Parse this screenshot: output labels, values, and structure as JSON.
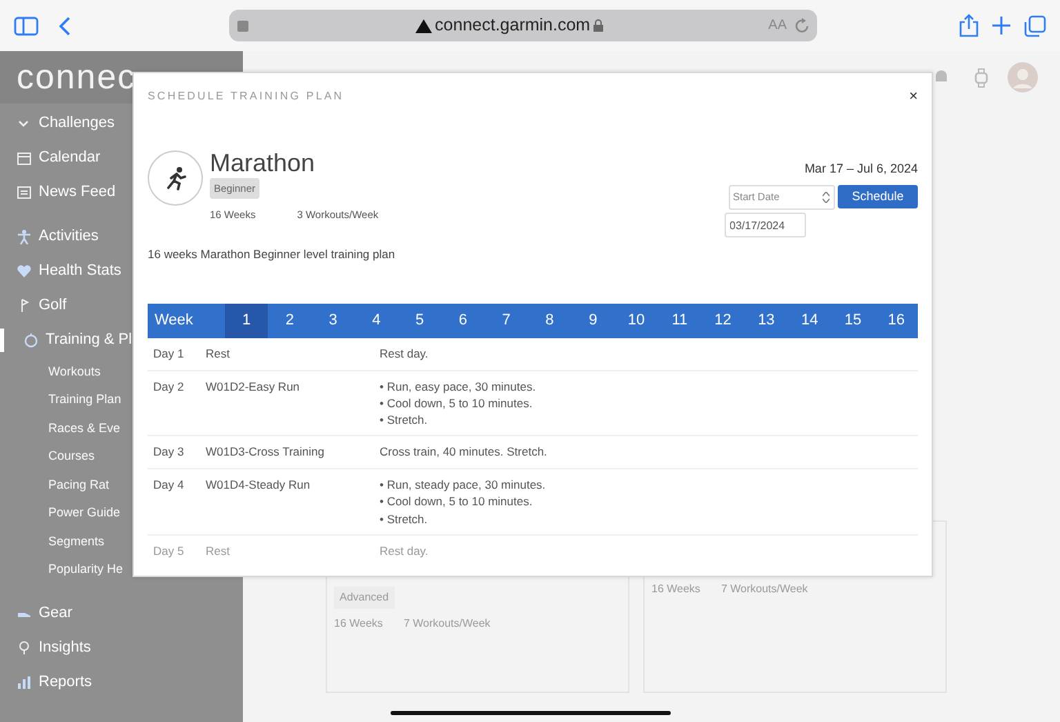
{
  "browser": {
    "url": "connect.garmin.com",
    "text_size": "AA"
  },
  "sidebar": {
    "logo": "connec",
    "items": [
      {
        "label": "Challenges",
        "selected": false
      },
      {
        "label": "Calendar",
        "selected": false
      },
      {
        "label": "News Feed",
        "selected": false
      },
      {
        "label": "Activities",
        "selected": false
      },
      {
        "label": "Health Stats",
        "selected": false
      },
      {
        "label": "Golf",
        "selected": false
      },
      {
        "label": "Training & Pl",
        "selected": true,
        "children": [
          {
            "label": "Workouts"
          },
          {
            "label": "Training Plan"
          },
          {
            "label": "Races & Eve"
          },
          {
            "label": "Courses"
          },
          {
            "label": "Pacing Rat"
          },
          {
            "label": "Power Guide"
          },
          {
            "label": "Segments"
          },
          {
            "label": "Popularity He"
          }
        ]
      },
      {
        "label": "Gear",
        "selected": false
      },
      {
        "label": "Insights",
        "selected": false
      },
      {
        "label": "Reports",
        "selected": false
      }
    ]
  },
  "background_cards": [
    {
      "level": "Advanced",
      "weeks": "16 Weeks",
      "workouts": "7 Workouts/Week"
    },
    {
      "weeks": "16 Weeks",
      "workouts": "7 Workouts/Week"
    }
  ],
  "modal": {
    "title": "SCHEDULE TRAINING PLAN",
    "close": "×",
    "plan": {
      "name": "Marathon",
      "level": "Beginner",
      "weeks": "16 Weeks",
      "workouts": "3 Workouts/Week",
      "date_range": "Mar 17 – Jul 6, 2024",
      "description": "16 weeks Marathon Beginner level training plan"
    },
    "start_select": {
      "placeholder": "Start Date"
    },
    "start_date": "03/17/2024",
    "schedule_button": "Schedule",
    "week_label": "Week",
    "weeks": [
      {
        "label": "1",
        "selected": true
      },
      {
        "label": "2",
        "selected": false
      },
      {
        "label": "3",
        "selected": false
      },
      {
        "label": "4",
        "selected": false
      },
      {
        "label": "5",
        "selected": false
      },
      {
        "label": "6",
        "selected": false
      },
      {
        "label": "7",
        "selected": false
      },
      {
        "label": "8",
        "selected": false
      },
      {
        "label": "9",
        "selected": false
      },
      {
        "label": "10",
        "selected": false
      },
      {
        "label": "11",
        "selected": false
      },
      {
        "label": "12",
        "selected": false
      },
      {
        "label": "13",
        "selected": false
      },
      {
        "label": "14",
        "selected": false
      },
      {
        "label": "15",
        "selected": false
      },
      {
        "label": "16",
        "selected": false
      }
    ],
    "days": [
      {
        "day": "Day 1",
        "workout": "Rest",
        "details": [
          "Rest day."
        ],
        "faded": false
      },
      {
        "day": "Day 2",
        "workout": "W01D2-Easy Run",
        "details": [
          "• Run, easy pace, 30 minutes.",
          "• Cool down, 5 to 10 minutes.",
          "• Stretch."
        ],
        "faded": false
      },
      {
        "day": "Day 3",
        "workout": "W01D3-Cross Training",
        "details": [
          "Cross train, 40 minutes. Stretch."
        ],
        "faded": false
      },
      {
        "day": "Day 4",
        "workout": "W01D4-Steady Run",
        "details": [
          "• Run, steady pace, 30 minutes.",
          "• Cool down, 5 to 10 minutes.",
          "• Stretch."
        ],
        "faded": false
      },
      {
        "day": "Day 5",
        "workout": "Rest",
        "details": [
          "Rest day."
        ],
        "faded": true
      }
    ]
  }
}
